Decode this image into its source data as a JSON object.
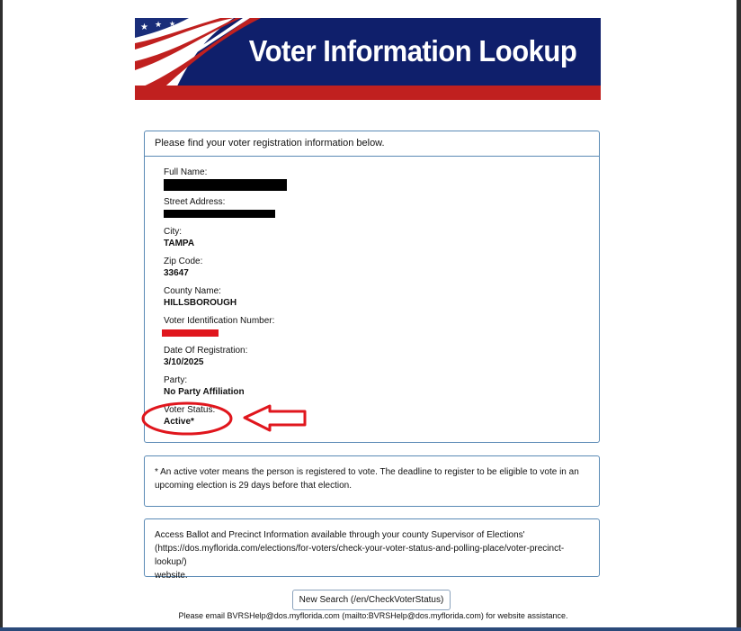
{
  "banner": {
    "title": "Voter Information Lookup"
  },
  "main_panel": {
    "heading": "Please find your voter registration information below.",
    "fields": {
      "full_name": {
        "label": "Full Name:",
        "value": ""
      },
      "street_address": {
        "label": "Street Address:",
        "value": ""
      },
      "city": {
        "label": "City:",
        "value": "TAMPA"
      },
      "zip_code": {
        "label": "Zip Code:",
        "value": "33647"
      },
      "county": {
        "label": "County Name:",
        "value": "HILLSBOROUGH"
      },
      "voter_id": {
        "label": "Voter Identification Number:",
        "value": ""
      },
      "registration_date": {
        "label": "Date Of Registration:",
        "value": "3/10/2025"
      },
      "party": {
        "label": "Party:",
        "value": "No Party Affiliation"
      },
      "status": {
        "label": "Voter Status:",
        "value": "Active*"
      }
    }
  },
  "note_panel": {
    "text": "* An active voter means the person is registered to vote. The deadline to register to be eligible to vote in an upcoming election is 29 days before that election."
  },
  "access_panel": {
    "line1": "Access Ballot and Precinct Information available through your county Supervisor of Elections'",
    "line2": "(https://dos.myflorida.com/elections/for-voters/check-your-voter-status-and-polling-place/voter-precinct-lookup/)",
    "line3": "website."
  },
  "new_search_button": {
    "label": "New Search (/en/CheckVoterStatus)"
  },
  "footer": {
    "text": "Please email BVRSHelp@dos.myflorida.com (mailto:BVRSHelp@dos.myflorida.com) for website assistance."
  },
  "colors": {
    "banner_blue": "#0f1f6b",
    "banner_red": "#c0201f",
    "panel_border": "#5a8ab5",
    "annotation_red": "#e0161d"
  },
  "icons": [
    "flag-stars-icon",
    "annotation-circle-icon",
    "annotation-arrow-icon"
  ]
}
